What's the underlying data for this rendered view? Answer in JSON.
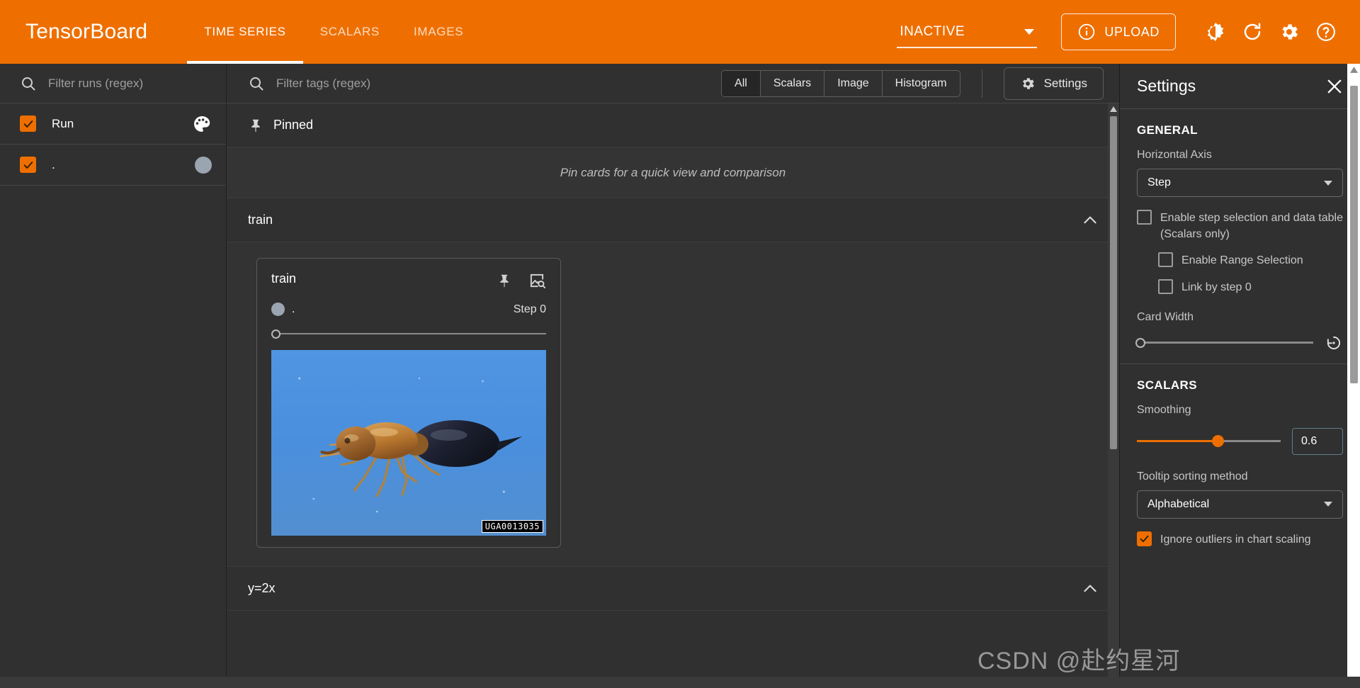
{
  "app": {
    "brand": "TensorBoard",
    "tabs": [
      {
        "label": "TIME SERIES",
        "active": true
      },
      {
        "label": "SCALARS",
        "active": false
      },
      {
        "label": "IMAGES",
        "active": false
      }
    ],
    "status_select": "INACTIVE",
    "upload_label": "UPLOAD",
    "icons": {
      "info": "info-icon",
      "brightness": "brightness-icon",
      "refresh": "refresh-icon",
      "gear": "gear-icon",
      "help": "help-icon"
    }
  },
  "sidebar": {
    "filter_placeholder": "Filter runs (regex)",
    "runs": [
      {
        "label": "Run",
        "checked": true,
        "icon": "palette-icon"
      },
      {
        "label": ".",
        "checked": true,
        "icon": "color-dot"
      }
    ]
  },
  "tagbar": {
    "filter_placeholder": "Filter tags (regex)",
    "filters": [
      {
        "label": "All",
        "selected": true
      },
      {
        "label": "Scalars",
        "selected": false
      },
      {
        "label": "Image",
        "selected": false
      },
      {
        "label": "Histogram",
        "selected": false
      }
    ],
    "settings_label": "Settings"
  },
  "content": {
    "pinned": {
      "title": "Pinned",
      "empty_text": "Pin cards for a quick view and comparison"
    },
    "groups": [
      {
        "title": "train"
      },
      {
        "title": "y=2x"
      }
    ],
    "card": {
      "title": "train",
      "run_name": ".",
      "step_label": "Step 0",
      "image_watermark": "UGA0013035",
      "pin_icon": "pin-icon",
      "fullsize_icon": "image-search-icon"
    }
  },
  "settings": {
    "title": "Settings",
    "general": {
      "heading": "GENERAL",
      "horizontal_axis_label": "Horizontal Axis",
      "horizontal_axis_value": "Step",
      "enable_step_selection": "Enable step selection and data table (Scalars only)",
      "enable_step_selection_checked": false,
      "enable_range_selection": "Enable Range Selection",
      "enable_range_selection_checked": false,
      "link_by_step": "Link by step 0",
      "link_by_step_checked": false,
      "card_width_label": "Card Width",
      "card_width_reset_icon": "reset-icon"
    },
    "scalars": {
      "heading": "SCALARS",
      "smoothing_label": "Smoothing",
      "smoothing_value": "0.6",
      "tooltip_sorting_label": "Tooltip sorting method",
      "tooltip_sorting_value": "Alphabetical",
      "ignore_outliers": "Ignore outliers in chart scaling",
      "ignore_outliers_checked": true
    }
  },
  "overlay": {
    "watermark": "CSDN @赴约星河"
  },
  "colors": {
    "brand_orange": "#ee6f00",
    "panel_bg": "#303030",
    "run_color": "#9aa5b1"
  }
}
